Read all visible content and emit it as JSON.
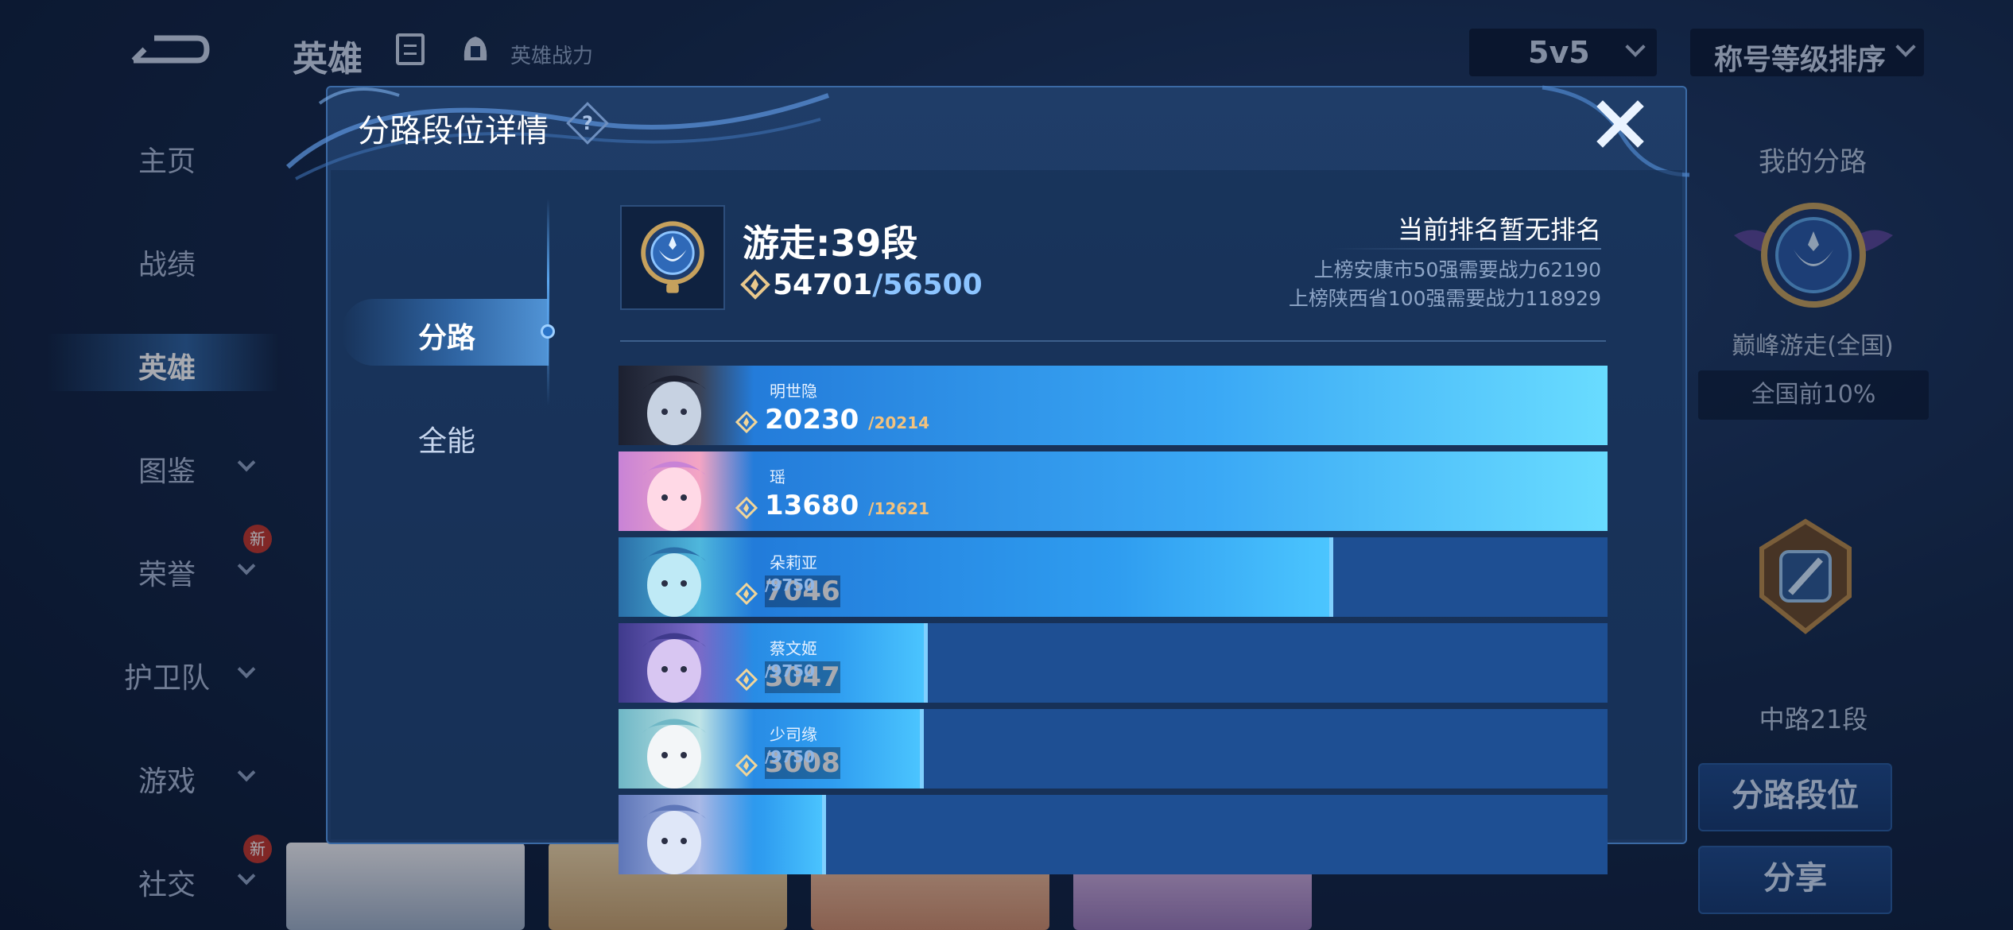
{
  "header": {
    "title": "英雄",
    "subtitle": "英雄战力",
    "mode_value": "5v5",
    "sort_value": "称号等级排序"
  },
  "sidebar": {
    "items": [
      {
        "label": "主页"
      },
      {
        "label": "战绩"
      },
      {
        "label": "英雄"
      },
      {
        "label": "图鉴"
      },
      {
        "label": "荣誉",
        "badge": "新"
      },
      {
        "label": "护卫队"
      },
      {
        "label": "游戏"
      },
      {
        "label": "社交",
        "badge": "新"
      }
    ]
  },
  "right_panel": {
    "title": "我的分路",
    "emblem_label": "巅峰游走(全国)",
    "percentile": "全国前10%",
    "mid_label": "中路21段",
    "lane_rank_button": "分路段位",
    "share_button": "分享"
  },
  "modal": {
    "title": "分路段位详情",
    "help_label": "?",
    "tabs": [
      {
        "label": "分路"
      },
      {
        "label": "全能"
      }
    ],
    "rank_title": "游走:39段",
    "power_current": "54701",
    "power_max": "/56500",
    "ranking_status": "当前排名暂无排名",
    "requirements": [
      "上榜安康市50强需要战力62190",
      "上榜陕西省100强需要战力118929"
    ],
    "heroes": [
      {
        "name": "明世隐",
        "power": "20230",
        "max": "/20214",
        "fill": 1.0,
        "palette": "ming"
      },
      {
        "name": "瑶",
        "power": "13680",
        "max": "/12621",
        "fill": 1.0,
        "palette": "yao"
      },
      {
        "name": "朵莉亚",
        "power": "7046",
        "max": "/9750",
        "fill": 0.7227,
        "palette": "doria"
      },
      {
        "name": "蔡文姬",
        "power": "3047",
        "max": "/9750",
        "fill": 0.3125,
        "palette": "cai"
      },
      {
        "name": "少司缘",
        "power": "3008",
        "max": "/9750",
        "fill": 0.3085,
        "palette": "shao"
      },
      {
        "name": "",
        "power": "",
        "max": "",
        "fill": 0.21,
        "palette": "sixth"
      }
    ]
  },
  "colors": {
    "accent": "#2f9df0",
    "max_over": "#f2c27e",
    "max_under": "#8fb6e6",
    "rank_max": "#8cc4ff"
  }
}
